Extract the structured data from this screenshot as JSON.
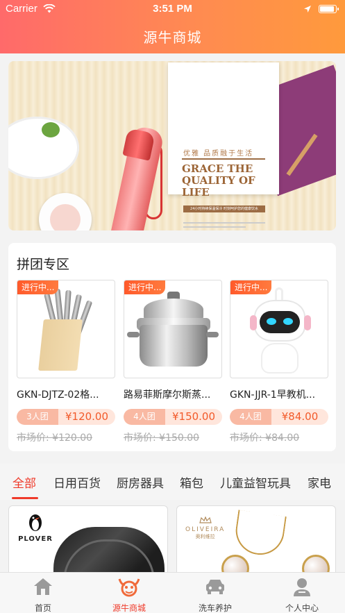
{
  "status_bar": {
    "carrier": "Carrier",
    "time": "3:51 PM"
  },
  "header": {
    "title": "源牛商城"
  },
  "banner": {
    "slogan": "优雅 品质融于生活",
    "headline": "GRACE THE QUALITY OF LIFE",
    "subline": "24小时持续保温保冷 时刻呵护您的健康饮水"
  },
  "group_buy": {
    "title": "拼团专区",
    "items": [
      {
        "tag": "进行中...",
        "name": "GKN-DJTZ-02格...",
        "group_size": "3人团",
        "price": "¥120.00",
        "market_price": "市场价: ¥120.00",
        "image": "knife-set"
      },
      {
        "tag": "进行中...",
        "name": "路易菲斯摩尔斯蒸...",
        "group_size": "4人团",
        "price": "¥150.00",
        "market_price": "市场价: ¥150.00",
        "image": "steamer-pot"
      },
      {
        "tag": "进行中...",
        "name": "GKN-JJR-1早教机...",
        "group_size": "4人团",
        "price": "¥84.00",
        "market_price": "市场价: ¥84.00",
        "image": "robot-toy"
      }
    ]
  },
  "category_tabs": {
    "active_index": 0,
    "items": [
      "全部",
      "日用百货",
      "厨房器具",
      "箱包",
      "儿童益智玩具",
      "家电"
    ]
  },
  "feed": {
    "items": [
      {
        "brand": "PLOVER",
        "image": "leather-belt"
      },
      {
        "brand": "OLIVEIRA",
        "brand_sub": "奥利维拉",
        "image": "pearl-pendant"
      }
    ]
  },
  "tab_bar": {
    "active_index": 1,
    "items": [
      {
        "label": "首页",
        "icon": "home-icon"
      },
      {
        "label": "源牛商城",
        "icon": "bull-icon"
      },
      {
        "label": "洗车养护",
        "icon": "car-icon"
      },
      {
        "label": "个人中心",
        "icon": "person-icon"
      }
    ]
  },
  "colors": {
    "accent": "#ef3a2a",
    "header_start": "#ff6a6a",
    "header_end": "#ff9a3c",
    "price": "#f25a2a"
  }
}
